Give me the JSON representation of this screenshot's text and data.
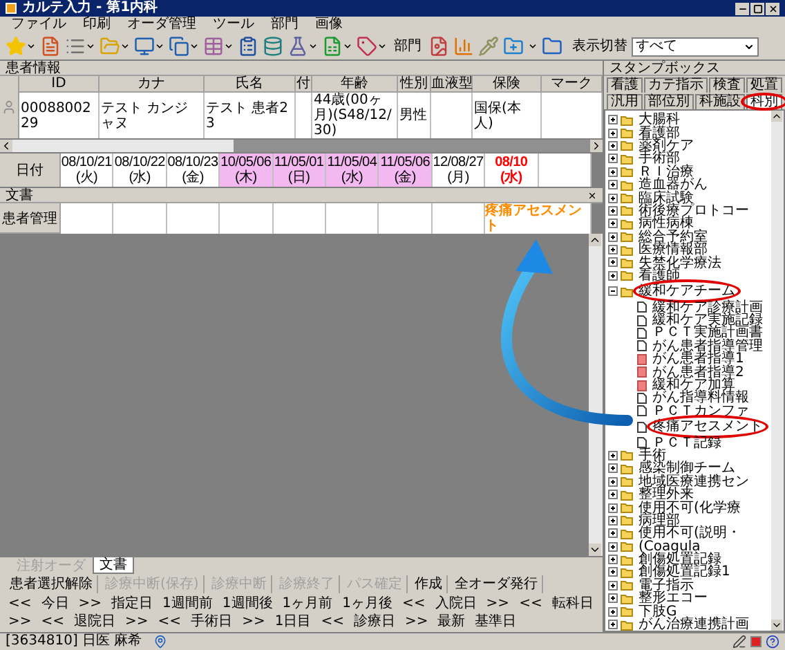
{
  "window": {
    "title": "カルテ入力 - 第1内科"
  },
  "menu": [
    "ファイル",
    "印刷",
    "オーダ管理",
    "ツール",
    "部門",
    "画像"
  ],
  "toolbar": {
    "dept_button": "部門",
    "filter_label": "表示切替",
    "filter_value": "すべて"
  },
  "patient_panel": {
    "title": "患者情報",
    "columns": [
      {
        "label": "ID",
        "value": "0008800229"
      },
      {
        "label": "カナ",
        "value": "テスト カンジャヌ"
      },
      {
        "label": "氏名",
        "value": "テスト 患者23"
      },
      {
        "label": "付"
      },
      {
        "label": "年齢",
        "value": "44歳(00ヶ月)(S48/12/30)"
      },
      {
        "label": "性別",
        "value": "男性"
      },
      {
        "label": "血液型"
      },
      {
        "label": "保険",
        "value": "国保(本人)"
      },
      {
        "label": "マーク"
      }
    ]
  },
  "dates": {
    "label": "日付",
    "items": [
      {
        "text": "08/10/21(火)",
        "kind": "normal"
      },
      {
        "text": "08/10/22(水)",
        "kind": "normal"
      },
      {
        "text": "08/10/23(金)",
        "kind": "normal"
      },
      {
        "text": "10/05/06(木)",
        "kind": "highlight"
      },
      {
        "text": "11/05/01(日)",
        "kind": "highlight"
      },
      {
        "text": "11/05/04(水)",
        "kind": "highlight"
      },
      {
        "text": "11/05/06(金)",
        "kind": "highlight"
      },
      {
        "text": "12/08/27(月)",
        "kind": "normal"
      },
      {
        "text": "08/10(水)",
        "kind": "today"
      }
    ]
  },
  "document_section": {
    "title": "文書",
    "rows": [
      {
        "label": "患者管理",
        "entry": {
          "text": "疼痛アセスメント"
        }
      }
    ]
  },
  "bottom_tabs": [
    {
      "label": "注射オーダ",
      "selected": false,
      "disabled": true
    },
    {
      "label": "文書",
      "selected": true,
      "disabled": false
    }
  ],
  "actions": [
    {
      "label": "患者選択解除",
      "disabled": false
    },
    {
      "label": "診療中断(保存)",
      "disabled": true
    },
    {
      "label": "診療中断",
      "disabled": true
    },
    {
      "label": "診療終了",
      "disabled": true
    },
    {
      "label": "パス確定",
      "disabled": true
    },
    {
      "label": "作成",
      "disabled": false
    },
    {
      "label": "全オーダ発行",
      "disabled": false
    }
  ],
  "navigation": [
    "<<",
    "今日",
    ">>",
    "指定日",
    "1週間前",
    "1週間後",
    "1ヶ月前",
    "1ヶ月後",
    "<<",
    "入院日",
    ">>",
    "<<",
    "転科日",
    ">>",
    "<<",
    "退院日",
    ">>",
    "<<",
    "手術日",
    ">>",
    "1日目",
    "<<",
    "診療日",
    ">>",
    "最新",
    "基準日"
  ],
  "status_bar": {
    "patient": "[3634810] 日医 麻希"
  },
  "stamp_box": {
    "title": "スタンプボックス",
    "tab_rows": [
      {
        "tabs": [
          {
            "label": "看護",
            "selected": false,
            "circled": false
          },
          {
            "label": "カテ指示",
            "selected": false,
            "circled": false
          },
          {
            "label": "検査",
            "selected": false,
            "circled": false
          },
          {
            "label": "処置",
            "selected": false,
            "circled": false
          }
        ]
      },
      {
        "tabs": [
          {
            "label": "汎用",
            "selected": false,
            "circled": false
          },
          {
            "label": "部位別",
            "selected": false,
            "circled": false
          },
          {
            "label": "科施設",
            "selected": false,
            "circled": false
          },
          {
            "label": "科別",
            "selected": true,
            "circled": true
          }
        ]
      }
    ],
    "tree": [
      {
        "label": "大腸科",
        "kind": "folder",
        "expanded": false,
        "circled": false
      },
      {
        "label": "看護部",
        "kind": "folder",
        "expanded": false,
        "circled": false
      },
      {
        "label": "薬剤ケア",
        "kind": "folder",
        "expanded": false,
        "circled": false
      },
      {
        "label": "手術部",
        "kind": "folder",
        "expanded": false,
        "circled": false
      },
      {
        "label": "ＲＩ治療",
        "kind": "folder",
        "expanded": false,
        "circled": false
      },
      {
        "label": "造血器がん",
        "kind": "folder",
        "expanded": false,
        "circled": false
      },
      {
        "label": "臨床試験",
        "kind": "folder",
        "expanded": false,
        "circled": false
      },
      {
        "label": "術後療プロトコー",
        "kind": "folder",
        "expanded": false,
        "circled": false
      },
      {
        "label": "病性病棟",
        "kind": "folder",
        "expanded": false,
        "circled": false
      },
      {
        "label": "総合予約室",
        "kind": "folder",
        "expanded": false,
        "circled": false
      },
      {
        "label": "医療情報部",
        "kind": "folder",
        "expanded": false,
        "circled": false
      },
      {
        "label": "失禁化学療法",
        "kind": "folder",
        "expanded": false,
        "circled": false
      },
      {
        "label": "看護師",
        "kind": "folder",
        "expanded": false,
        "circled": false
      },
      {
        "label": "緩和ケアチーム",
        "kind": "folder",
        "expanded": true,
        "circled": true,
        "children": [
          {
            "label": "緩和ケア診療計画",
            "kind": "document",
            "circled": false
          },
          {
            "label": "緩和ケア実施記録",
            "kind": "document",
            "circled": false
          },
          {
            "label": "ＰＣＴ実施計画書",
            "kind": "document",
            "circled": false
          },
          {
            "label": "がん患者指導管理",
            "kind": "document",
            "circled": false
          },
          {
            "label": "がん患者指導1",
            "kind": "note",
            "circled": false
          },
          {
            "label": "がん患者指導2",
            "kind": "note",
            "circled": false
          },
          {
            "label": "緩和ケア加算",
            "kind": "note",
            "circled": false
          },
          {
            "label": "がん指導料情報",
            "kind": "document",
            "circled": false
          },
          {
            "label": "ＰＣＴカンファ",
            "kind": "document",
            "circled": false
          },
          {
            "label": "疼痛アセスメント",
            "kind": "document",
            "circled": true
          },
          {
            "label": "ＰＣＴ記録",
            "kind": "document",
            "circled": false
          }
        ]
      },
      {
        "label": "手術",
        "kind": "folder",
        "expanded": false,
        "circled": false
      },
      {
        "label": "感染制御チーム",
        "kind": "folder",
        "expanded": false,
        "circled": false
      },
      {
        "label": "地域医療連携セン",
        "kind": "folder",
        "expanded": false,
        "circled": false
      },
      {
        "label": "整理外来",
        "kind": "folder",
        "expanded": false,
        "circled": false
      },
      {
        "label": "使用不可(化学療",
        "kind": "folder",
        "expanded": false,
        "circled": false
      },
      {
        "label": "病理部",
        "kind": "folder",
        "expanded": false,
        "circled": false
      },
      {
        "label": "使用不可(説明・",
        "kind": "folder",
        "expanded": false,
        "circled": false
      },
      {
        "label": "(Coagula",
        "kind": "folder",
        "expanded": false,
        "circled": false
      },
      {
        "label": "創傷処置記録",
        "kind": "folder",
        "expanded": false,
        "circled": false
      },
      {
        "label": "創傷処置記録1",
        "kind": "folder",
        "expanded": false,
        "circled": false
      },
      {
        "label": "電子指示",
        "kind": "folder",
        "expanded": false,
        "circled": false
      },
      {
        "label": "整形エコー",
        "kind": "folder",
        "expanded": false,
        "circled": false
      },
      {
        "label": "下肢G",
        "kind": "folder",
        "expanded": false,
        "circled": false
      },
      {
        "label": "がん治療連携計画",
        "kind": "folder",
        "expanded": false,
        "circled": false
      }
    ]
  }
}
